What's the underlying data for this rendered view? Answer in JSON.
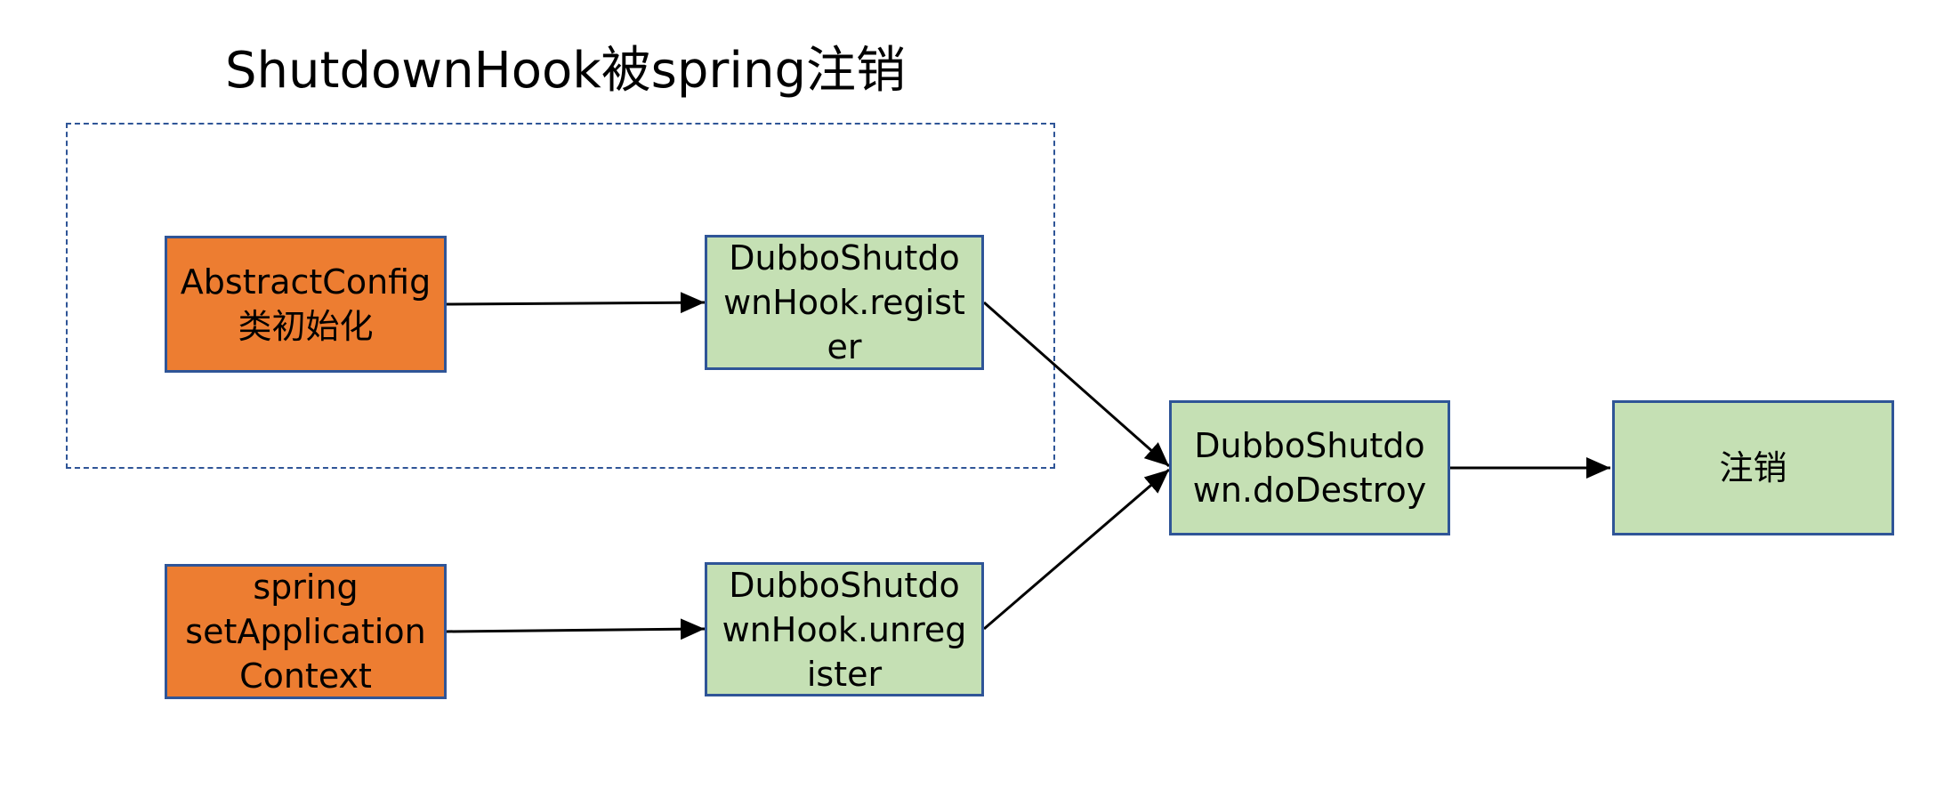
{
  "title": "ShutdownHook被spring注销",
  "colors": {
    "orange_fill": "#ed7d31",
    "green_fill": "#c5e0b4",
    "box_border": "#2f5597",
    "group_border": "#2f5597",
    "arrow": "#000000"
  },
  "nodes": {
    "abstract_config": "AbstractConfig\n类初始化",
    "register": "DubboShutdo\nwnHook.regist\ner",
    "spring_context": "spring\nsetApplication\nContext",
    "unregister": "DubboShutdo\nwnHook.unreg\nister",
    "do_destroy": "DubboShutdo\nwn.doDestroy",
    "logout": "注销"
  },
  "edges": [
    {
      "from": "abstract_config",
      "to": "register"
    },
    {
      "from": "spring_context",
      "to": "unregister"
    },
    {
      "from": "register",
      "to": "do_destroy"
    },
    {
      "from": "unregister",
      "to": "do_destroy"
    },
    {
      "from": "do_destroy",
      "to": "logout"
    }
  ]
}
